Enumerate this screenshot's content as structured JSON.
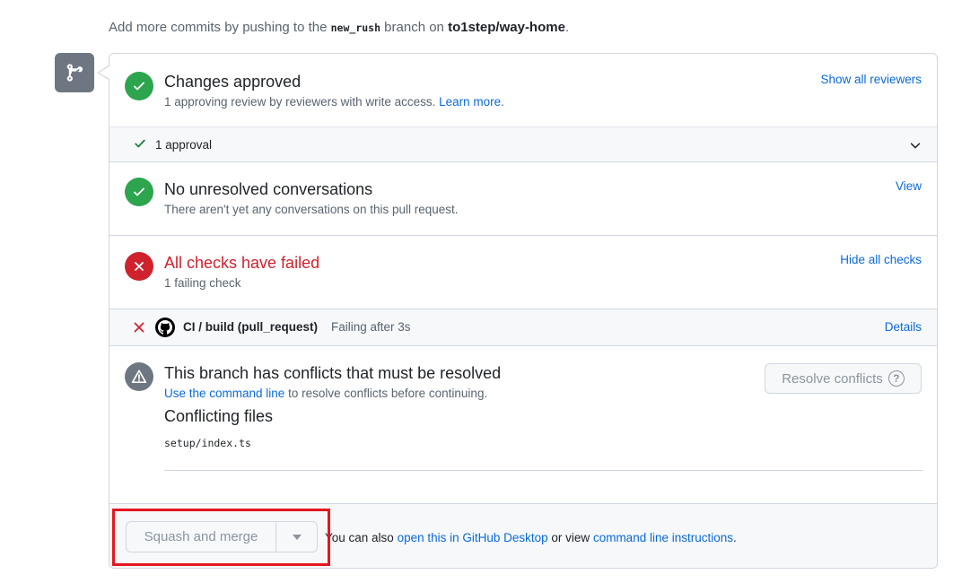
{
  "intro": {
    "prefix": "Add more commits by pushing to the ",
    "branch": "new_rush",
    "middle": " branch on ",
    "repo": "to1step/way-home",
    "suffix": "."
  },
  "approvals": {
    "title": "Changes approved",
    "subtitle": "1 approving review by reviewers with write access. ",
    "learn_more": "Learn more",
    "subtitle_end": ".",
    "show_all": "Show all reviewers",
    "approval_count": "1 approval"
  },
  "conversations": {
    "title": "No unresolved conversations",
    "subtitle": "There aren't yet any conversations on this pull request.",
    "view": "View"
  },
  "checks": {
    "title": "All checks have failed",
    "subtitle": "1 failing check",
    "hide_all": "Hide all checks",
    "item": {
      "name": "CI / build (pull_request)",
      "status": "Failing after 3s",
      "details": "Details"
    }
  },
  "conflicts": {
    "title": "This branch has conflicts that must be resolved",
    "cmd_link": "Use the command line",
    "subtitle": " to resolve conflicts before continuing.",
    "resolve_button": "Resolve conflicts",
    "files_title": "Conflicting files",
    "files": [
      "setup/index.ts"
    ]
  },
  "footer": {
    "merge_button": "Squash and merge",
    "text_prefix": "You can also ",
    "desktop_link": "open this in GitHub Desktop",
    "text_middle": " or view ",
    "cli_link": "command line instructions",
    "text_suffix": "."
  },
  "colors": {
    "success": "#2da44e",
    "danger": "#cf222e",
    "link": "#0969da",
    "highlight": "#e5161f"
  }
}
